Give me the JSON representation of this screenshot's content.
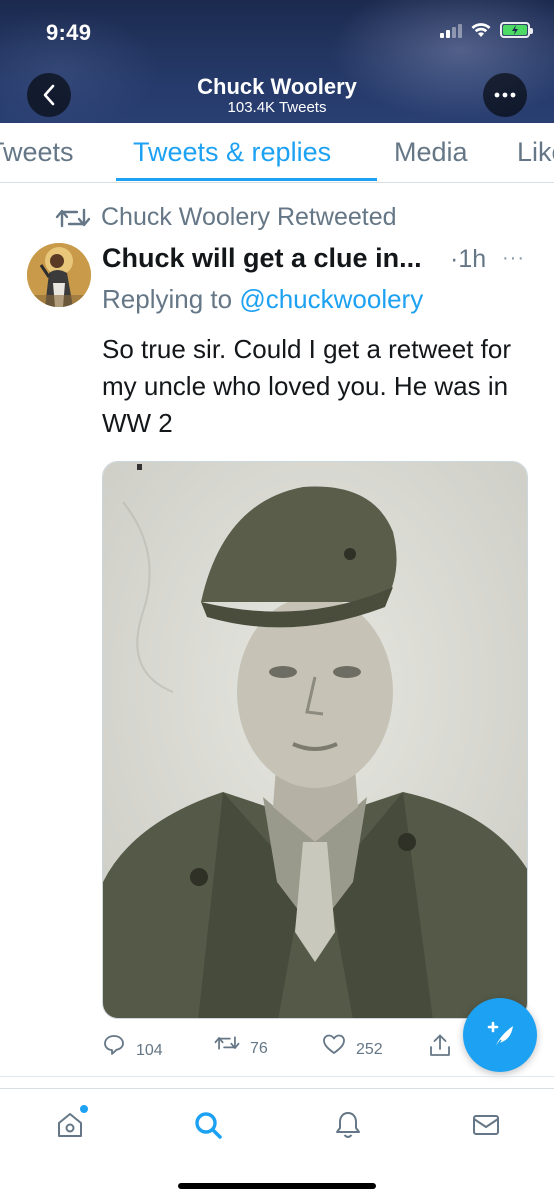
{
  "status_bar": {
    "time": "9:49"
  },
  "header": {
    "title": "Chuck Woolery",
    "subtitle": "103.4K Tweets",
    "back_icon": "chevron-left-icon",
    "more_icon": "more-horizontal-icon"
  },
  "tabs": [
    {
      "label": "Tweets",
      "active": false
    },
    {
      "label": "Tweets & replies",
      "active": true
    },
    {
      "label": "Media",
      "active": false
    },
    {
      "label": "Likes",
      "active": false
    }
  ],
  "tweet": {
    "retweet_label": "Chuck Woolery Retweeted",
    "author_name": "Chuck will get a clue in...",
    "time": "1h",
    "replying_prefix": "Replying to",
    "replying_handle": "@chuckwoolery",
    "text": "So true sir. Could I get a retweet for my uncle who loved you. He was in WW 2",
    "replies": "104",
    "retweets": "76",
    "likes": "252"
  },
  "colors": {
    "accent": "#1da1f2",
    "muted": "#657786",
    "header_bg": "#22345f"
  },
  "bottom_nav": {
    "items": [
      "home-icon",
      "search-icon",
      "notifications-bell-icon",
      "messages-envelope-icon"
    ],
    "active": "search-icon"
  }
}
